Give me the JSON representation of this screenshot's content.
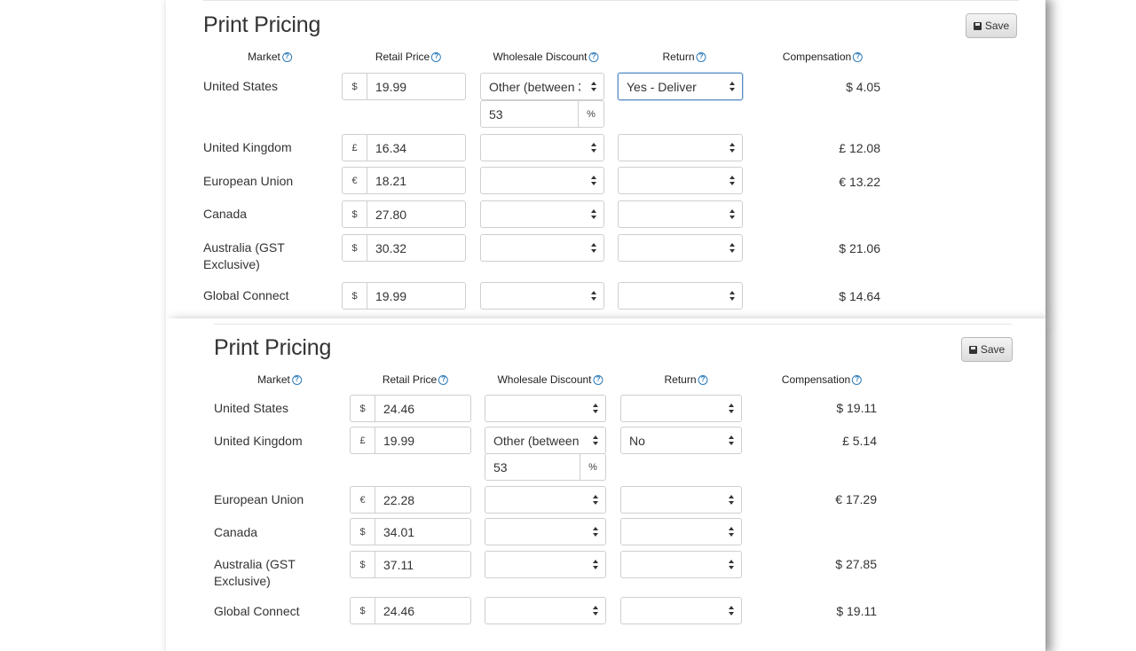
{
  "sections": [
    {
      "title": "Print Pricing",
      "save_label": "Save",
      "headers": {
        "market": "Market",
        "retail": "Retail Price",
        "wholesale": "Wholesale Discount",
        "return": "Return",
        "comp": "Compensation"
      },
      "rows": [
        {
          "market": "United States",
          "cur": "$",
          "price": "19.99",
          "wholesale": "Other (between 3",
          "pct": "53",
          "pct_sym": "%",
          "ret": "Yes - Deliver",
          "comp": "$ 4.05"
        },
        {
          "market": "United Kingdom",
          "cur": "£",
          "price": "16.34",
          "wholesale": "",
          "ret": "",
          "comp": "£ 12.08"
        },
        {
          "market": "European Union",
          "cur": "€",
          "price": "18.21",
          "wholesale": "",
          "ret": "",
          "comp": "€ 13.22"
        },
        {
          "market": "Canada",
          "cur": "$",
          "price": "27.80",
          "wholesale": "",
          "ret": "",
          "comp": ""
        },
        {
          "market": "Australia (GST Exclusive)",
          "cur": "$",
          "price": "30.32",
          "wholesale": "",
          "ret": "",
          "comp": "$ 21.06"
        },
        {
          "market": "Global Connect",
          "cur": "$",
          "price": "19.99",
          "wholesale": "",
          "ret": "",
          "comp": "$ 14.64"
        }
      ]
    },
    {
      "title": "Print Pricing",
      "save_label": "Save",
      "headers": {
        "market": "Market",
        "retail": "Retail Price",
        "wholesale": "Wholesale Discount",
        "return": "Return",
        "comp": "Compensation"
      },
      "rows": [
        {
          "market": "United States",
          "cur": "$",
          "price": "24.46",
          "wholesale": "",
          "ret": "",
          "comp": "$ 19.11"
        },
        {
          "market": "United Kingdom",
          "cur": "£",
          "price": "19.99",
          "wholesale": "Other (between 3",
          "pct": "53",
          "pct_sym": "%",
          "ret": "No",
          "comp": "£ 5.14"
        },
        {
          "market": "European Union",
          "cur": "€",
          "price": "22.28",
          "wholesale": "",
          "ret": "",
          "comp": "€ 17.29"
        },
        {
          "market": "Canada",
          "cur": "$",
          "price": "34.01",
          "wholesale": "",
          "ret": "",
          "comp": ""
        },
        {
          "market": "Australia (GST Exclusive)",
          "cur": "$",
          "price": "37.11",
          "wholesale": "",
          "ret": "",
          "comp": "$ 27.85"
        },
        {
          "market": "Global Connect",
          "cur": "$",
          "price": "24.46",
          "wholesale": "",
          "ret": "",
          "comp": "$ 19.11"
        }
      ]
    }
  ]
}
